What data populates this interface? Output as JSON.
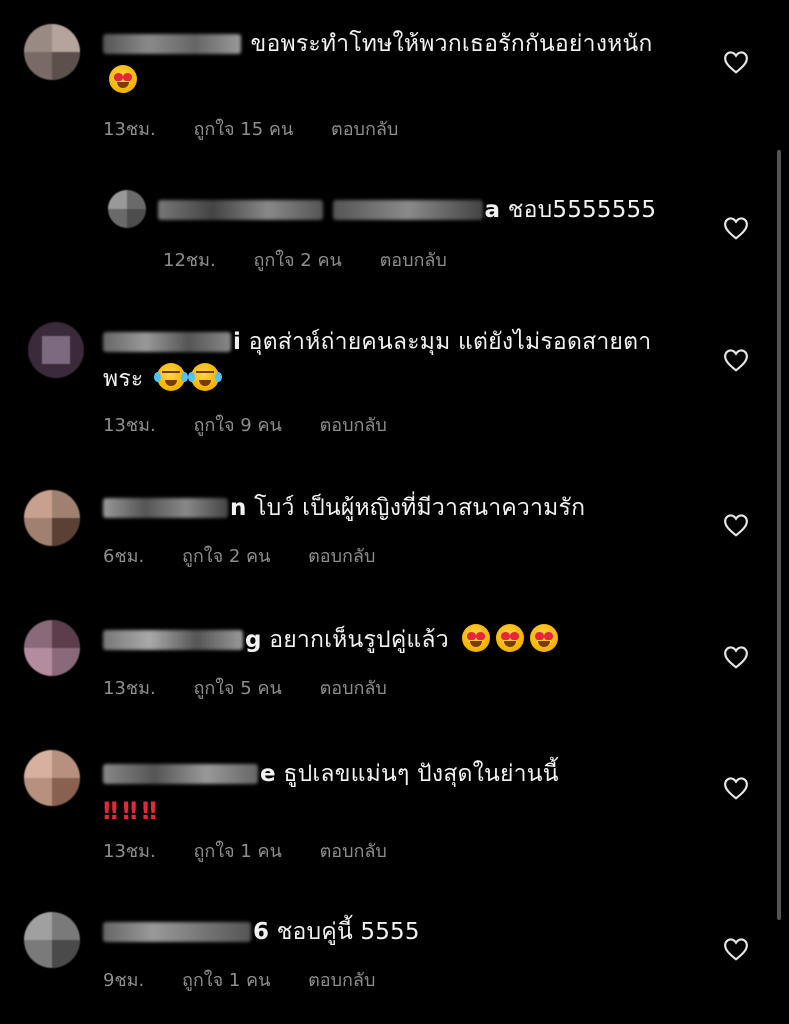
{
  "comments": [
    {
      "text": "ขอพระทำโทษให้พวกเธอรักกันอย่างหนัก",
      "time": "13ชม.",
      "likes": "ถูกใจ 15 คน",
      "reply": "ตอบกลับ",
      "emoji": [
        "heart-eyes-emoji"
      ]
    },
    {
      "text_prefix": "a",
      "text": "ชอบ5555555",
      "time": "12ชม.",
      "likes": "ถูกใจ 2 คน",
      "reply": "ตอบกลับ",
      "nested": true
    },
    {
      "text_prefix": "i",
      "text": "อุตส่าห์ถ่ายคนละมุม แต่ยังไม่รอดสายตาพระ",
      "time": "13ชม.",
      "likes": "ถูกใจ 9 คน",
      "reply": "ตอบกลับ",
      "emoji": [
        "tears-of-joy-emoji",
        "tears-of-joy-emoji"
      ]
    },
    {
      "text_prefix": "n",
      "text": "โบว์ เป็นผู้หญิงที่มีวาสนาความรัก",
      "time": "6ชม.",
      "likes": "ถูกใจ 2 คน",
      "reply": "ตอบกลับ"
    },
    {
      "text_prefix": "g",
      "text": "อยากเห็นรูปคู่แล้ว",
      "time": "13ชม.",
      "likes": "ถูกใจ 5 คน",
      "reply": "ตอบกลับ",
      "emoji": [
        "heart-eyes-emoji",
        "heart-eyes-emoji",
        "heart-eyes-emoji"
      ]
    },
    {
      "text_prefix": "e",
      "text": "ธูปเลขแม่นๆ ปังสุดในย่านนี้",
      "bangs": "‼ ‼ ‼",
      "time": "13ชม.",
      "likes": "ถูกใจ 1 คน",
      "reply": "ตอบกลับ"
    },
    {
      "text_prefix": "6",
      "text": "ชอบคู่นี้ 5555",
      "time": "9ชม.",
      "likes": "ถูกใจ 1 คน",
      "reply": "ตอบกลับ"
    }
  ],
  "icons": {
    "like": "heart-outline-icon"
  },
  "colors": {
    "background": "#000000",
    "meta": "#8e8e8e",
    "text": "#f2f2f2"
  }
}
